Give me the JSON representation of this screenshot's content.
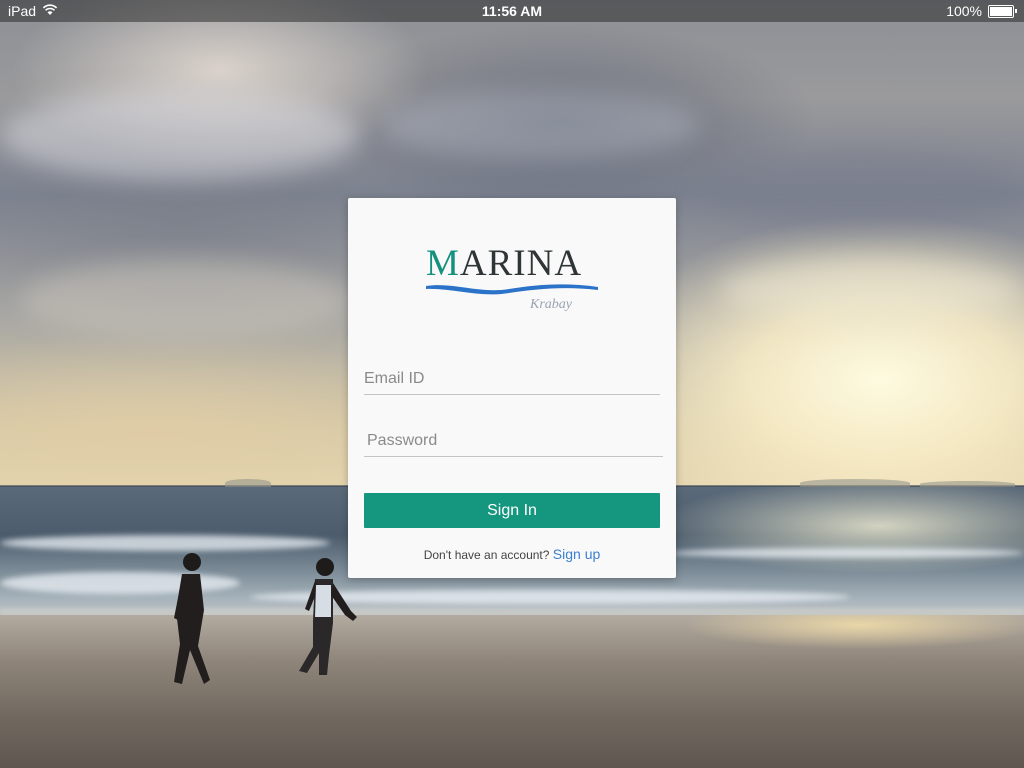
{
  "status_bar": {
    "device": "iPad",
    "time": "11:56 AM",
    "battery": "100%",
    "battery_level": 1.0
  },
  "login": {
    "logo": {
      "first_letter": "M",
      "rest": "ARINA",
      "tagline": "Krabay"
    },
    "email_placeholder": "Email ID",
    "password_placeholder": "Password",
    "signin_label": "Sign In",
    "signup_prompt": "Don't have an account?",
    "signup_link": "Sign up"
  },
  "colors": {
    "accent": "#14967f",
    "link": "#3b7fd0",
    "logo_wave": "#2a73c9"
  }
}
